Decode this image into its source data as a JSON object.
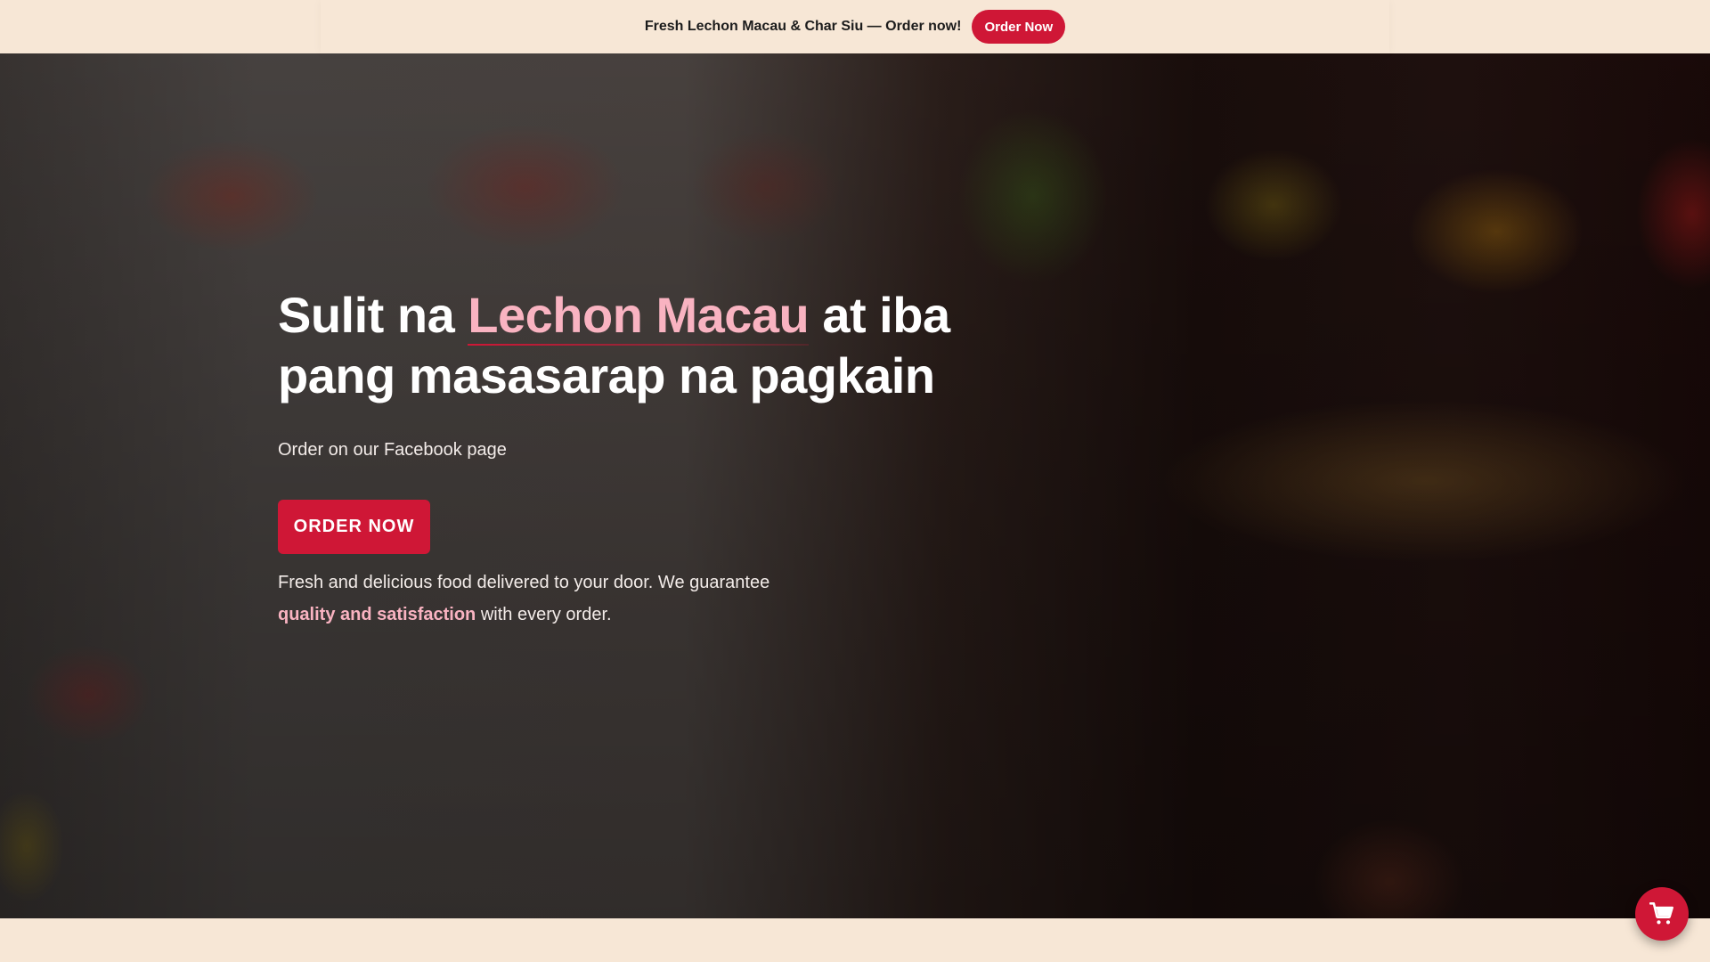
{
  "promo_bar": {
    "text": "Fresh Lechon Macau & Char Siu — Order now!",
    "button_label": "Order Now"
  },
  "hero": {
    "headline_part1": "Sulit na ",
    "headline_accent": "Lechon Macau",
    "headline_part2": " at iba pang masasarap na pagkain",
    "subheading": "Order on our Facebook page",
    "cta_label": "ORDER NOW",
    "description_part1": "Fresh and delicious food delivered to your door. We guarantee ",
    "description_highlight": "quality and satisfaction",
    "description_part2": " with every order."
  },
  "cart_button": {
    "icon": "shopping-cart-icon"
  },
  "colors": {
    "primary": "#cf1736",
    "accent_pink": "#f9b3c1",
    "cream": "#f7e7d6"
  }
}
